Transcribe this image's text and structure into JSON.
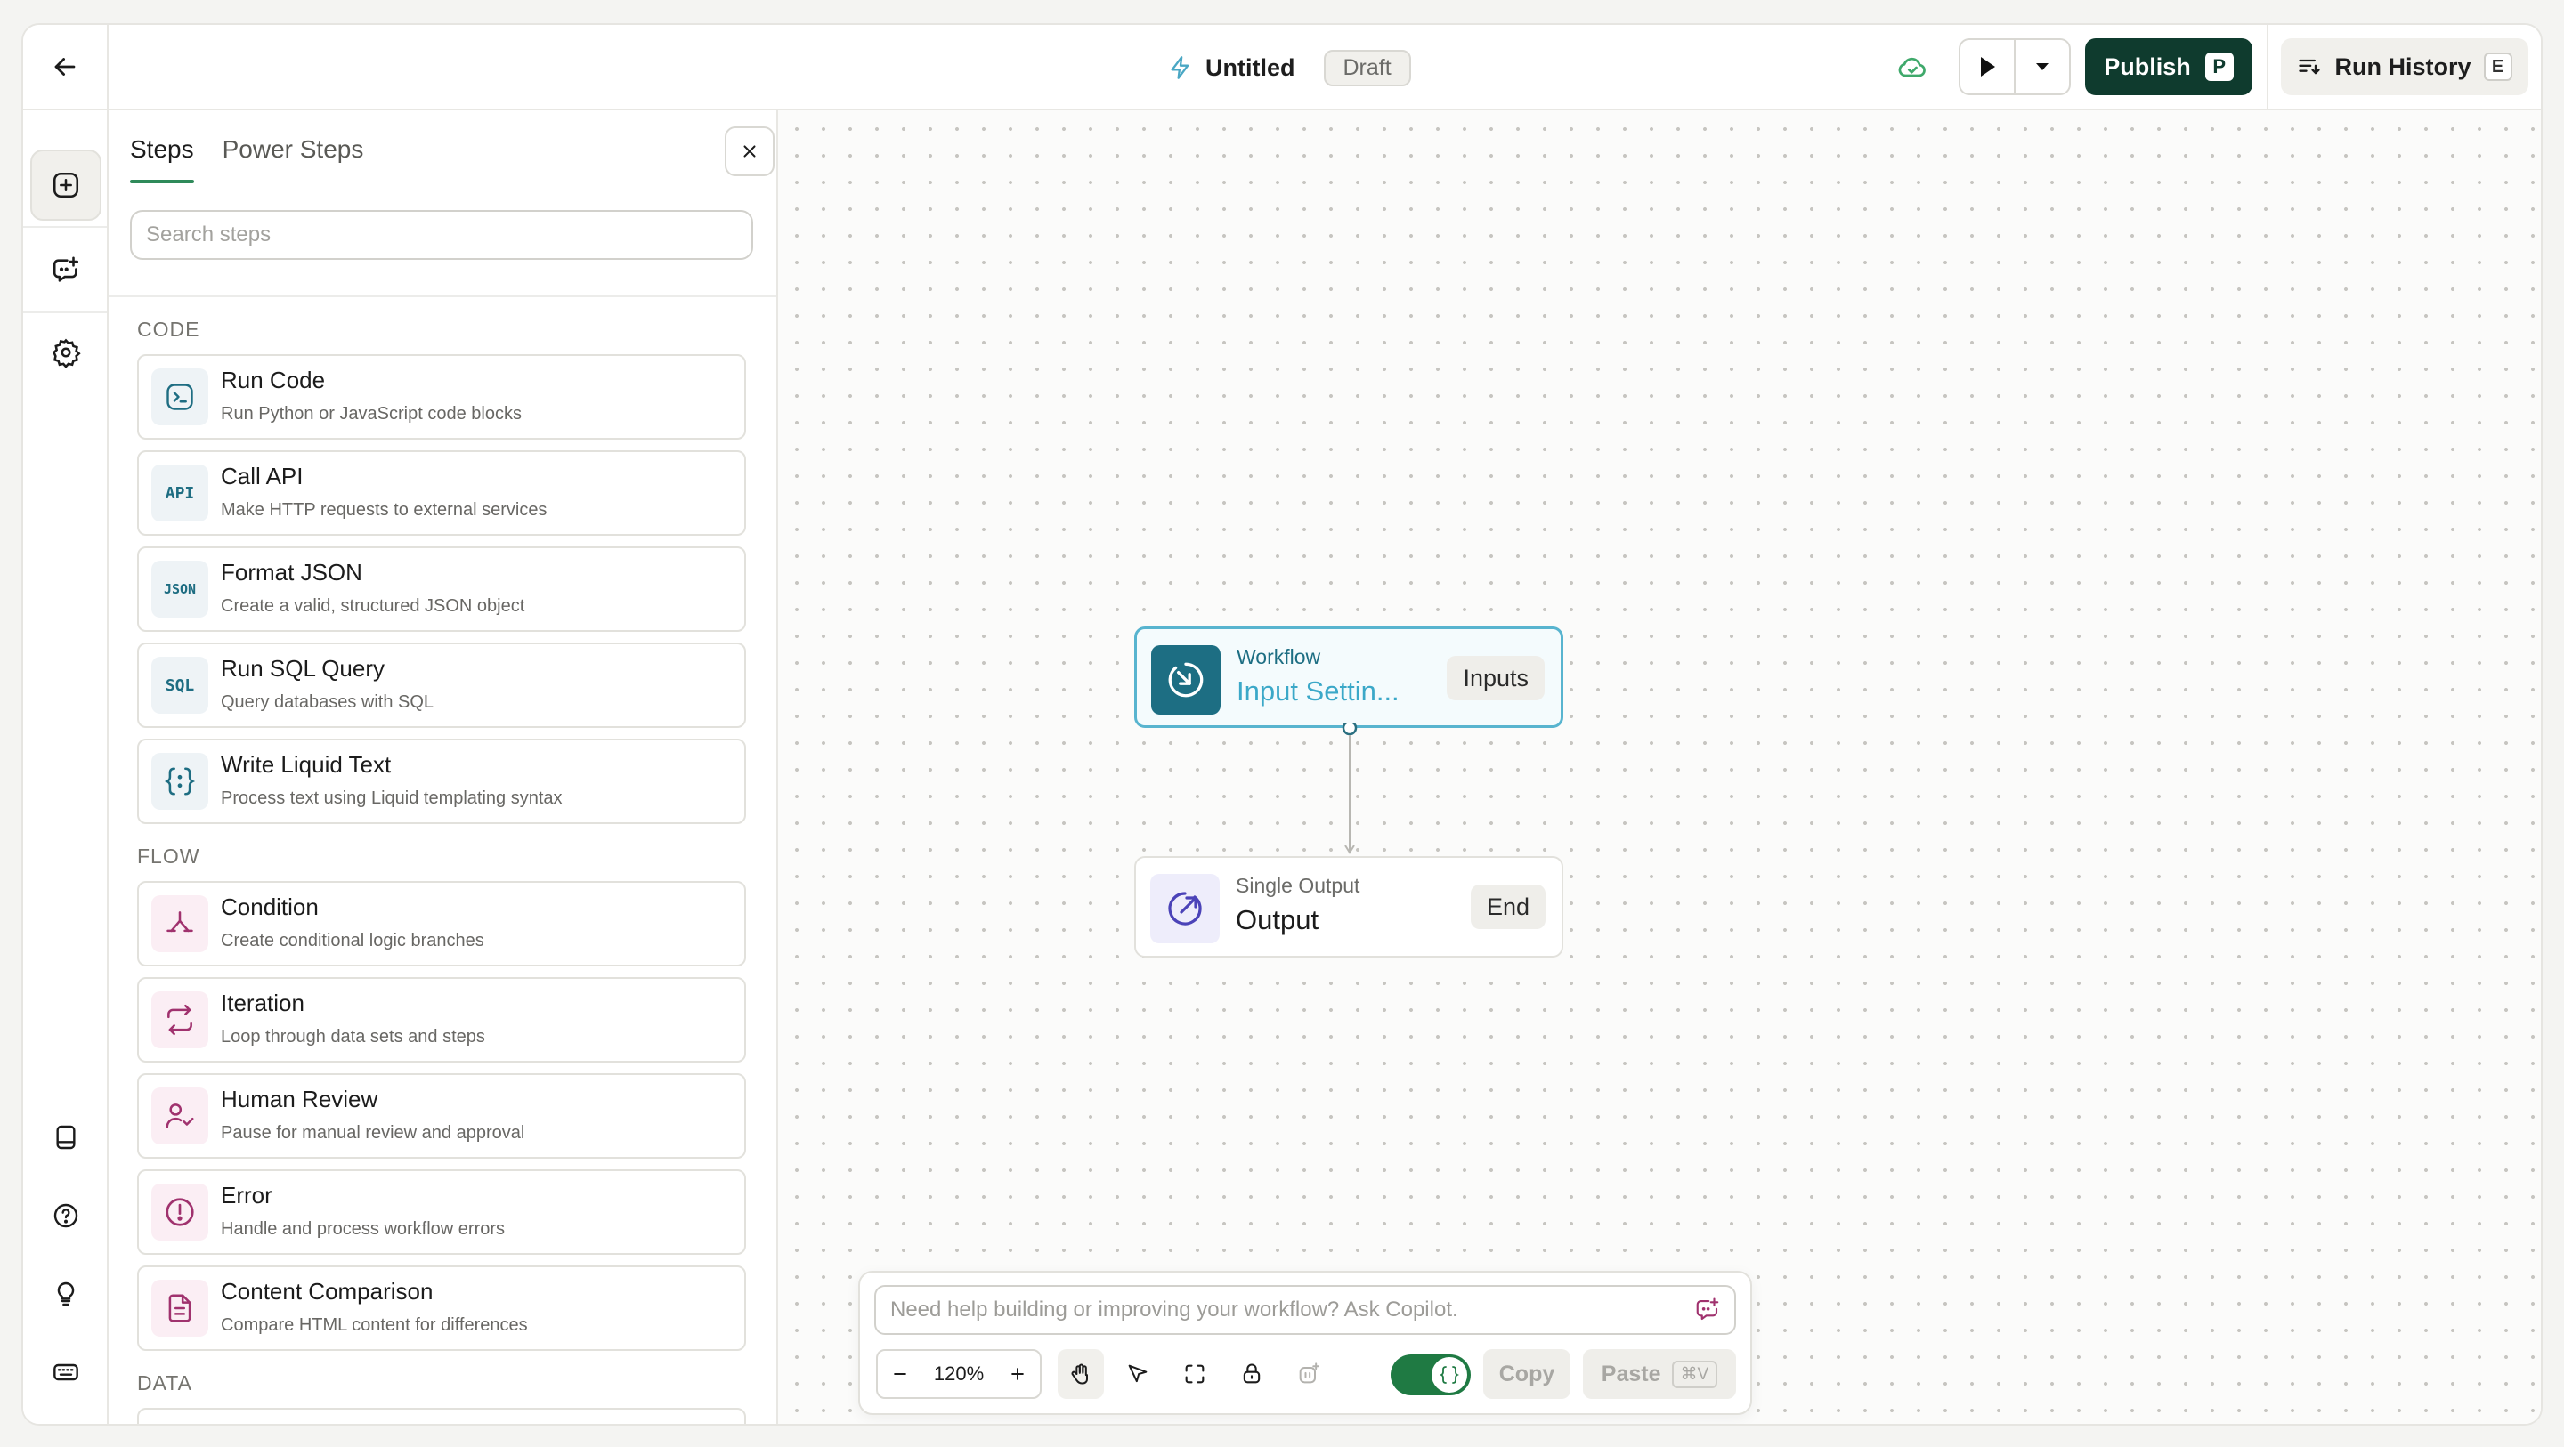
{
  "header": {
    "title": "Untitled",
    "status": "Draft",
    "publish_label": "Publish",
    "publish_shortcut": "P",
    "history_label": "Run History",
    "history_shortcut": "E"
  },
  "panel": {
    "tabs": [
      "Steps",
      "Power Steps"
    ],
    "active_tab": "Steps",
    "search_placeholder": "Search steps",
    "sections": [
      {
        "title": "CODE",
        "items": [
          {
            "name": "Run Code",
            "desc": "Run Python or JavaScript code blocks",
            "icon": "terminal-icon"
          },
          {
            "name": "Call API",
            "desc": "Make HTTP requests to external services",
            "icon": "api-icon"
          },
          {
            "name": "Format JSON",
            "desc": "Create a valid, structured JSON object",
            "icon": "json-icon"
          },
          {
            "name": "Run SQL Query",
            "desc": "Query databases with SQL",
            "icon": "sql-icon"
          },
          {
            "name": "Write Liquid Text",
            "desc": "Process text using Liquid templating syntax",
            "icon": "braces-icon"
          }
        ]
      },
      {
        "title": "FLOW",
        "items": [
          {
            "name": "Condition",
            "desc": "Create conditional logic branches",
            "icon": "branch-icon"
          },
          {
            "name": "Iteration",
            "desc": "Loop through data sets and steps",
            "icon": "loop-icon"
          },
          {
            "name": "Human Review",
            "desc": "Pause for manual review and approval",
            "icon": "user-check-icon"
          },
          {
            "name": "Error",
            "desc": "Handle and process workflow errors",
            "icon": "alert-circle-icon"
          },
          {
            "name": "Content Comparison",
            "desc": "Compare HTML content for differences",
            "icon": "file-compare-icon"
          }
        ]
      },
      {
        "title": "DATA",
        "items": []
      }
    ]
  },
  "canvas": {
    "nodes": [
      {
        "kind": "Workflow",
        "name": "Input Settin...",
        "tag": "Inputs"
      },
      {
        "kind": "Single Output",
        "name": "Output",
        "tag": "End"
      }
    ]
  },
  "toolbar": {
    "copilot_placeholder": "Need help building or improving your workflow? Ask Copilot.",
    "zoom": "120%",
    "copy_label": "Copy",
    "paste_label": "Paste",
    "paste_shortcut": "⌘V"
  },
  "colors": {
    "brand": "#0f3b2e",
    "accent_green": "#2f8a5a",
    "input_node_border": "#58b4cf",
    "input_node_icon_bg": "#1d6e83",
    "output_node_icon": "#4b43b8",
    "code_icon": "#1e6d82",
    "flow_icon": "#a0326e"
  }
}
